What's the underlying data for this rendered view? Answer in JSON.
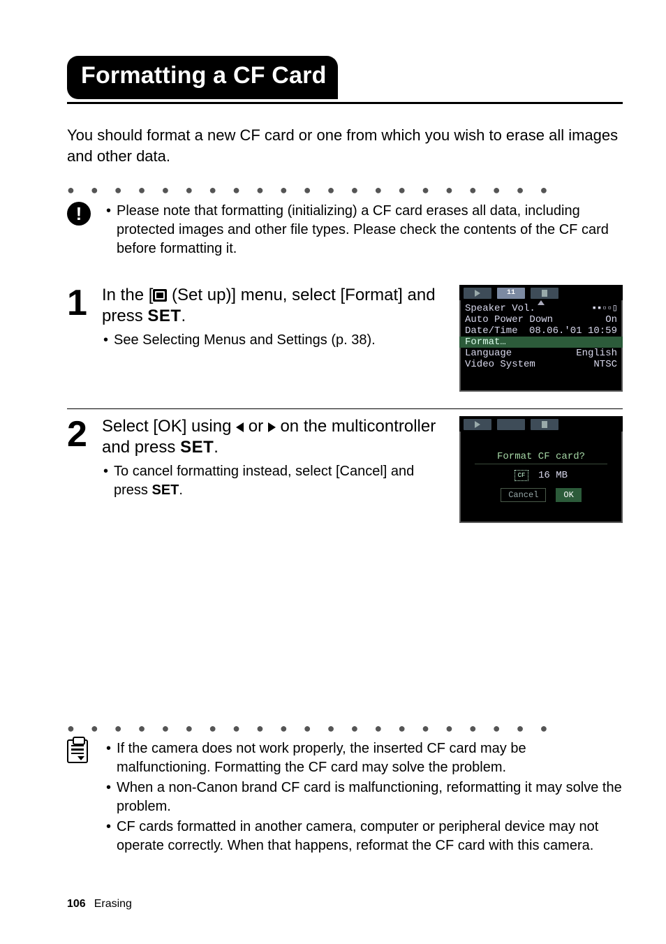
{
  "title": "Formatting a CF Card",
  "intro": "You should format a new CF card or one from which you wish to erase all images and other data.",
  "warn_bullet": "Please note that formatting (initializing) a CF card erases all data, including protected images and other file types. Please check the contents of the CF card before formatting it.",
  "step1": {
    "t1": "In the [",
    "t2": " (Set up)] menu, select [Format] and press ",
    "set": "SET",
    "t3": ".",
    "sub": "See Selecting Menus and Settings (p. 38)."
  },
  "lcd1": {
    "tools_label": "11",
    "rows": {
      "speaker_l": "Speaker Vol.",
      "speaker_v": "▪▪▫▫▯",
      "apd_l": "Auto Power Down",
      "apd_v": "On",
      "dt_l": "Date/Time",
      "dt_v": "08.06.'01 10:59",
      "fmt": "Format…",
      "lang_l": "Language",
      "lang_v": "English",
      "vid_l": "Video System",
      "vid_v": "NTSC"
    }
  },
  "step2": {
    "t1": "Select [OK] using ",
    "t2": " or ",
    "t3": " on the multicontroller and press ",
    "set": "SET",
    "t4": ".",
    "sub1": "To cancel formatting instead, select [Cancel] and press ",
    "sub_set": "SET",
    "sub2": "."
  },
  "lcd2": {
    "title": "Format CF card?",
    "cf": "CF",
    "size": "16 MB",
    "cancel": "Cancel",
    "ok": "OK"
  },
  "footer_bullets": [
    "If the camera does not work properly, the inserted CF card may be malfunctioning. Formatting the CF card may solve the problem.",
    "When a non-Canon brand CF card is malfunctioning, reformatting it may solve the problem.",
    "CF cards formatted in another camera, computer or peripheral device may not operate correctly. When that happens, reformat the CF card with this camera."
  ],
  "page_num": "106",
  "page_section": "Erasing"
}
